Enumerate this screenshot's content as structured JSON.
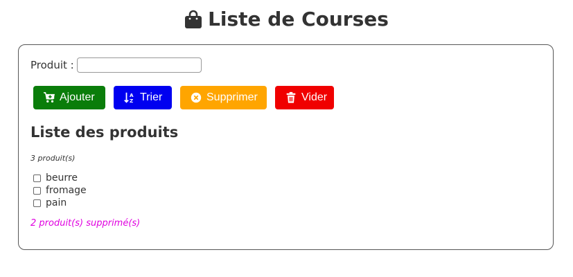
{
  "header": {
    "title": "Liste de Courses",
    "icon": "shopping-bag-icon"
  },
  "form": {
    "label": "Produit :",
    "input_value": "",
    "input_placeholder": ""
  },
  "buttons": {
    "add": {
      "label": "Ajouter",
      "color": "#0a7d0a",
      "icon": "cart-plus-icon"
    },
    "sort": {
      "label": "Trier",
      "color": "#0000f0",
      "icon": "sort-alpha-icon"
    },
    "remove": {
      "label": "Supprimer",
      "color": "#ffa500",
      "icon": "circle-x-icon"
    },
    "clear": {
      "label": "Vider",
      "color": "#f00000",
      "icon": "trash-icon"
    }
  },
  "list": {
    "heading": "Liste des produits",
    "count_text": "3 produit(s)",
    "items": [
      {
        "label": "beurre",
        "checked": false
      },
      {
        "label": "fromage",
        "checked": false
      },
      {
        "label": "pain",
        "checked": false
      }
    ],
    "deleted_text": "2 produit(s) supprimé(s)",
    "deleted_color": "#e000e0"
  }
}
